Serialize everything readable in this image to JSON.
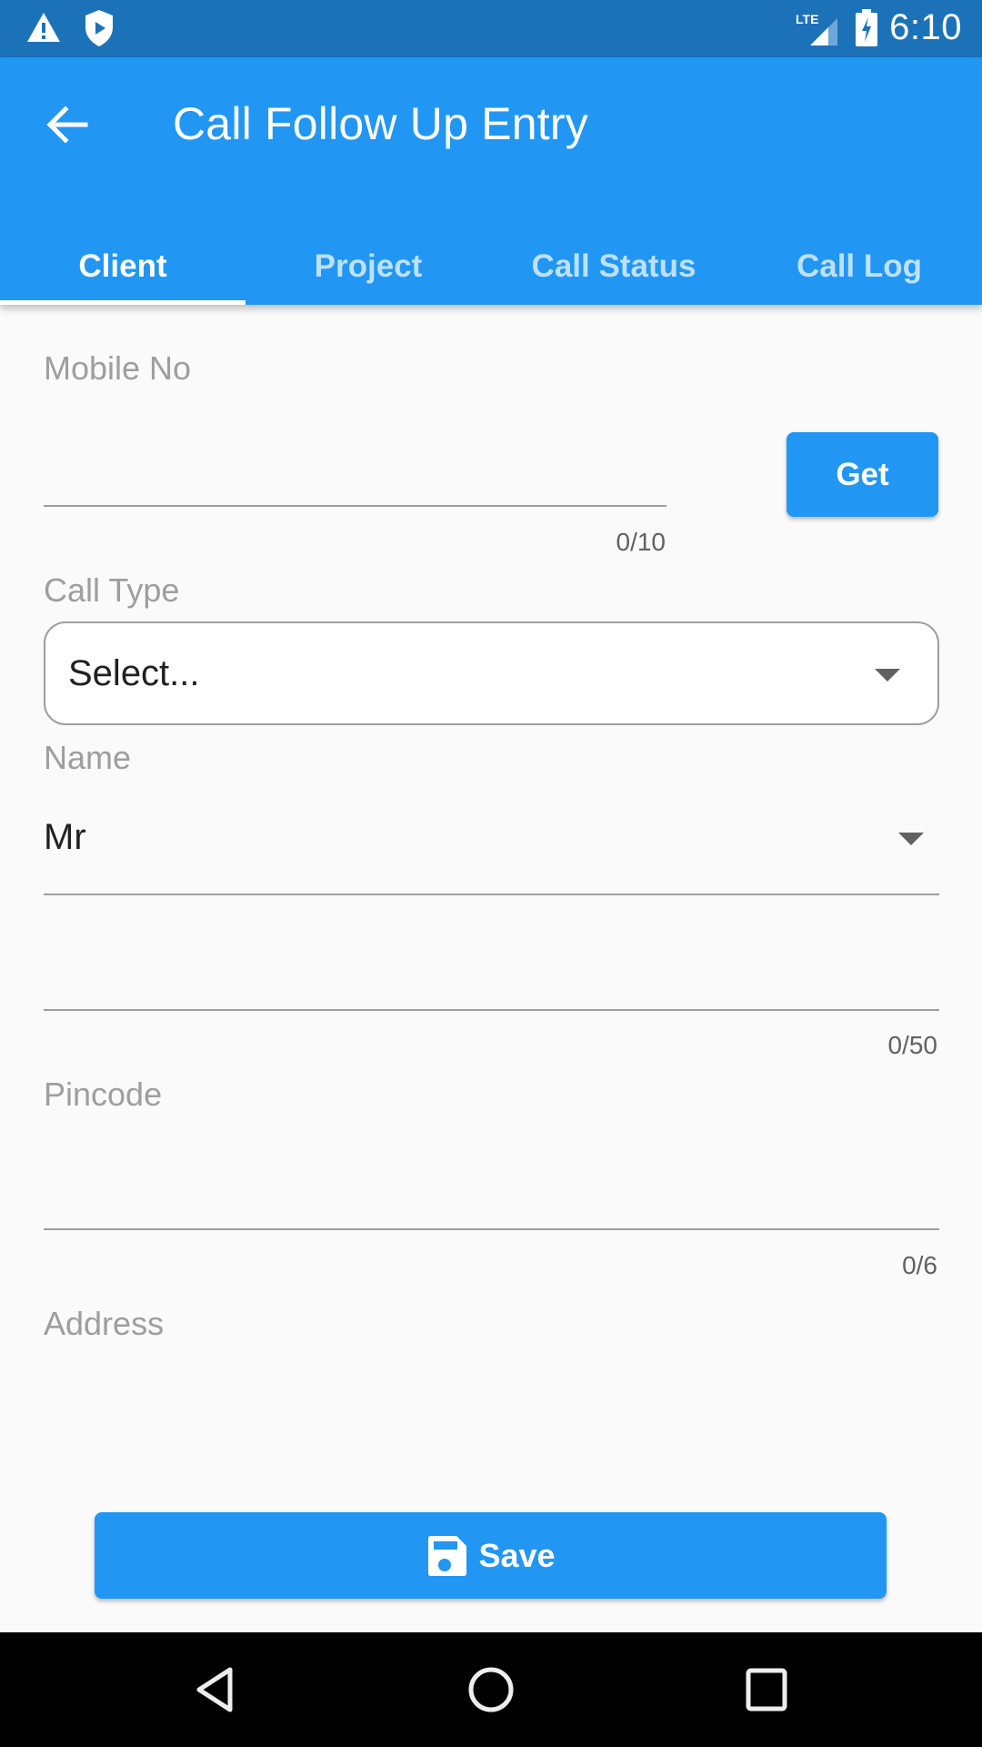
{
  "status_bar": {
    "time": "6:10",
    "network": "LTE",
    "icons": [
      "warning-icon",
      "shield-play-icon",
      "lte-signal-icon",
      "battery-charging-icon"
    ]
  },
  "app_bar": {
    "title": "Call Follow Up Entry",
    "back_icon": "arrow-back-icon"
  },
  "tabs": [
    {
      "label": "Client",
      "active": true
    },
    {
      "label": "Project",
      "active": false
    },
    {
      "label": "Call Status",
      "active": false
    },
    {
      "label": "Call Log",
      "active": false
    }
  ],
  "form": {
    "mobile": {
      "label": "Mobile No",
      "value": "",
      "counter": "0/10",
      "button_label": "Get"
    },
    "call_type": {
      "label": "Call Type",
      "selected": "Select..."
    },
    "name": {
      "label": "Name",
      "title_selected": "Mr",
      "value": "",
      "counter": "0/50"
    },
    "pincode": {
      "label": "Pincode",
      "value": "",
      "counter": "0/6"
    },
    "address": {
      "label": "Address",
      "value": ""
    }
  },
  "actions": {
    "save_label": "Save",
    "save_icon": "floppy-disk-icon"
  },
  "nav_bar": {
    "buttons": [
      "back",
      "home",
      "recents"
    ]
  },
  "colors": {
    "primary": "#2196f3",
    "status_bar": "#1c72b8",
    "label": "#9e9e9e",
    "background": "#fafafa"
  }
}
